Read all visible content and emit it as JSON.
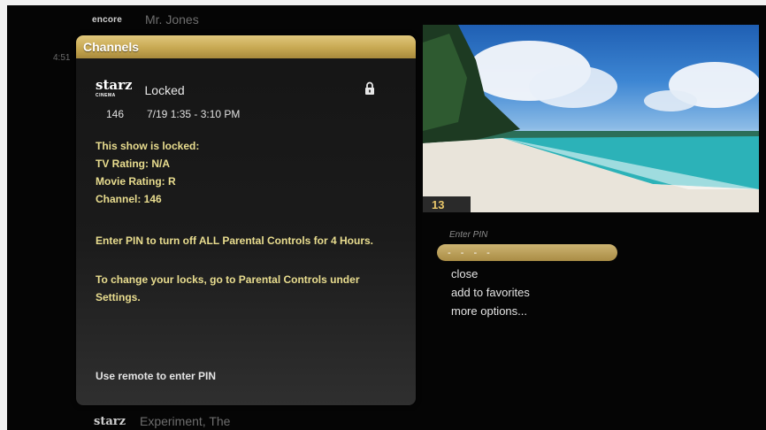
{
  "top_row": {
    "network": "encore",
    "title": "Mr. Jones"
  },
  "side_time": "4:51",
  "panel": {
    "header": "Channels",
    "network_logo": "starz",
    "network_logo_sub": "CINEMA",
    "status": "Locked",
    "channel_number": "146",
    "air_time": "7/19 1:35 - 3:10 PM",
    "lock_icon": "padlock-icon",
    "info_lines": [
      "This show is locked:",
      "TV Rating: N/A",
      "Movie Rating: R",
      "Channel: 146"
    ],
    "note_pin": "Enter PIN to turn off ALL Parental Controls for 4 Hours.",
    "note_settings": "To change your locks, go to Parental Controls under Settings.",
    "remote_hint": "Use remote to enter PIN"
  },
  "preview": {
    "channel_badge": "13"
  },
  "menu": {
    "pin_label": "Enter PIN",
    "pin_value": "- - - -",
    "items": [
      "close",
      "add to favorites",
      "more options..."
    ]
  },
  "bottom_row": {
    "network": "starz",
    "title": "Experiment, The"
  },
  "colors": {
    "accent_gold": "#c7a852",
    "info_text": "#e9dd8f",
    "background": "#050505"
  }
}
